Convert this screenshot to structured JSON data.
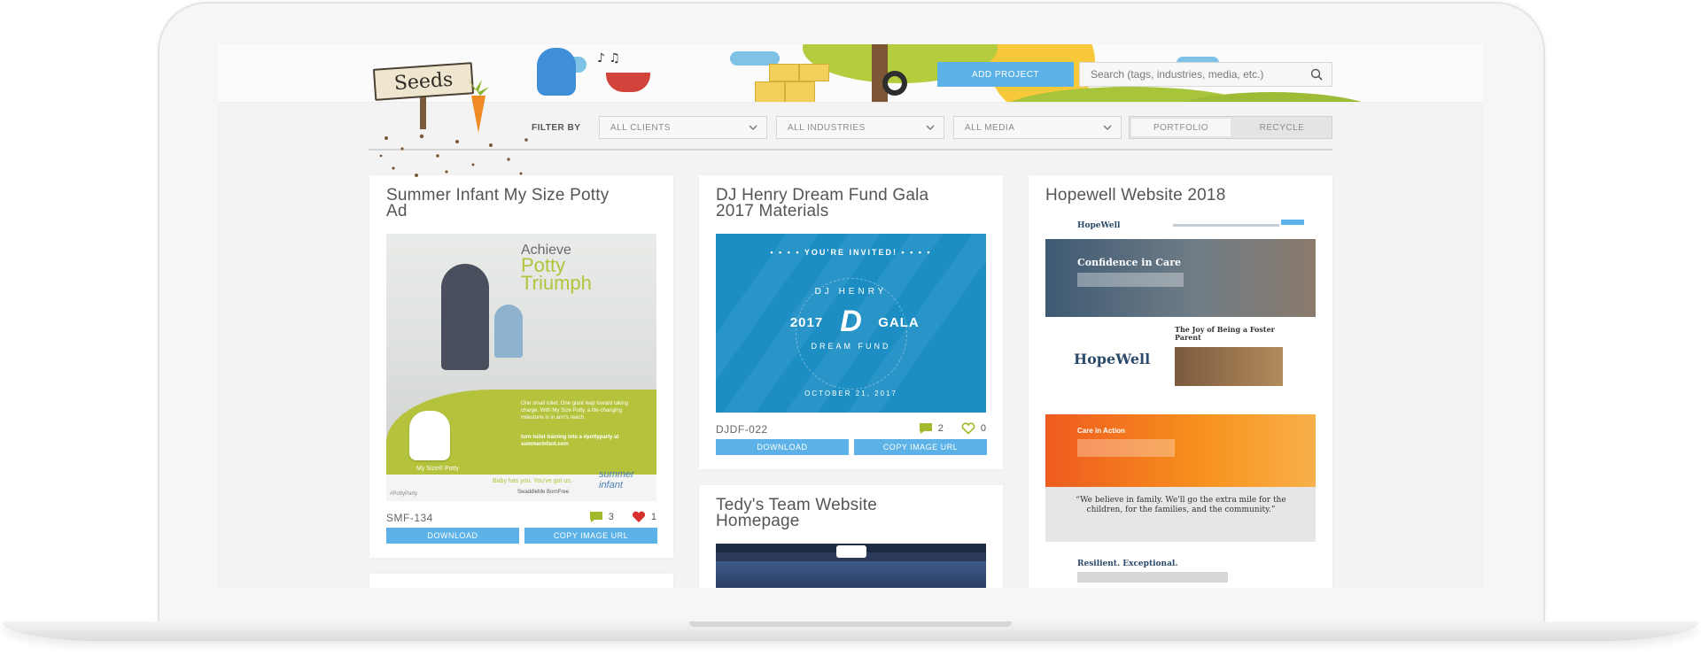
{
  "header": {
    "sign_text": "Seeds",
    "add_project_label": "ADD PROJECT",
    "search_placeholder": "Search (tags, industries, media, etc.)"
  },
  "filters": {
    "label": "FILTER BY",
    "clients": "ALL CLIENTS",
    "industries": "ALL INDUSTRIES",
    "media": "ALL MEDIA",
    "toggle": [
      "PORTFOLIO",
      "RECYCLE"
    ]
  },
  "cards": [
    {
      "title": "Summer Infant My Size Potty Ad",
      "code": "SMF-134",
      "comments": "3",
      "likes": "1",
      "download": "DOWNLOAD",
      "copy_url": "COPY IMAGE URL",
      "image": {
        "headline_1": "Achieve",
        "headline_2": "Potty",
        "headline_3": "Triumph",
        "body_1": "One small toilet. One giant leap toward taking charge. With My Size Potty, a life-changing milestone is in arm's reach.",
        "body_2": "turn toilet training into a #pottyparty at summerinfant.com",
        "product": "My Size® Potty",
        "tagline": "Baby has you. You've got us.",
        "partners": "SwaddleMe   BornFree",
        "hashtag": "#PottyParty",
        "logo": "summer infant"
      }
    },
    {
      "title": "DJ Henry Dream Fund Gala 2017 Materials",
      "code": "DJDF-022",
      "comments": "2",
      "likes": "0",
      "download": "DOWNLOAD",
      "copy_url": "COPY IMAGE URL",
      "image": {
        "invite": "• • • •  YOU'RE INVITED!  • • • •",
        "ring_top": "DJ HENRY",
        "year": "2017",
        "mark": "D",
        "gala": "GALA",
        "ring_bottom": "DREAM FUND",
        "date": "OCTOBER 21, 2017"
      }
    },
    {
      "title": "Hopewell Website 2018",
      "image": {
        "logo": "HopeWell",
        "hero_title": "Confidence in Care",
        "story_title": "The Joy of Being a Foster Parent",
        "care_title": "Care in Action",
        "quote": "“We believe in family. We'll go the extra mile for the children, for the families, and the community.”",
        "resilient": "Resilient. Exceptional."
      }
    },
    {
      "title": "Tedy's Team Website Homepage"
    }
  ],
  "colors": {
    "accent_blue": "#5cb2e6",
    "lime": "#b4c33b",
    "comment_green": "#a3b82b",
    "heart_red": "#d7312f",
    "gala_blue": "#1c8ec4",
    "hopewell_orange": "#f7931e"
  },
  "icons": [
    "search-icon",
    "chevron-down-icon",
    "comment-icon",
    "heart-icon"
  ]
}
